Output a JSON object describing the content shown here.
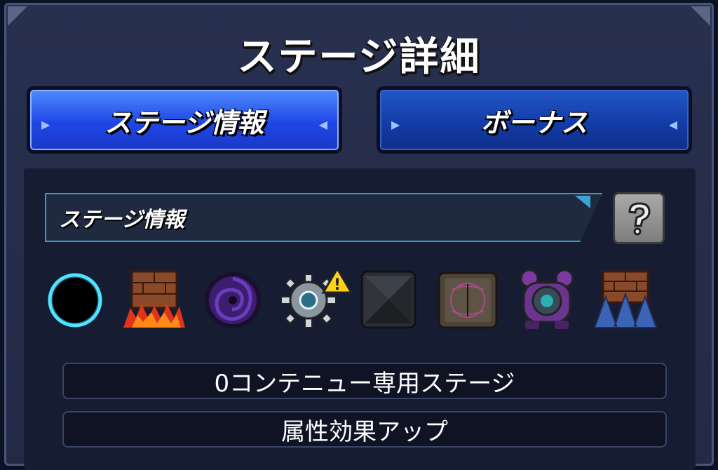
{
  "header": {
    "title": "ステージ詳細"
  },
  "tabs": [
    {
      "label": "ステージ情報",
      "active": true
    },
    {
      "label": "ボーナス",
      "active": false
    }
  ],
  "info_section": {
    "label": "ステージ情報",
    "help_icon": "question-icon"
  },
  "gimmicks": [
    {
      "name": "black-hole-icon"
    },
    {
      "name": "fire-wall-icon"
    },
    {
      "name": "warp-vortex-icon"
    },
    {
      "name": "spiked-mine-icon",
      "warning": true
    },
    {
      "name": "stone-block-icon"
    },
    {
      "name": "magic-panel-icon"
    },
    {
      "name": "shield-generator-icon"
    },
    {
      "name": "spike-wall-icon"
    }
  ],
  "notes": [
    "0コンテニュー専用ステージ",
    "属性効果アップ"
  ],
  "colors": {
    "tab_active": "#1f46e6",
    "tab_inactive": "#133ca8",
    "header_border": "#2f9fd1",
    "warning": "#ffd21a"
  }
}
